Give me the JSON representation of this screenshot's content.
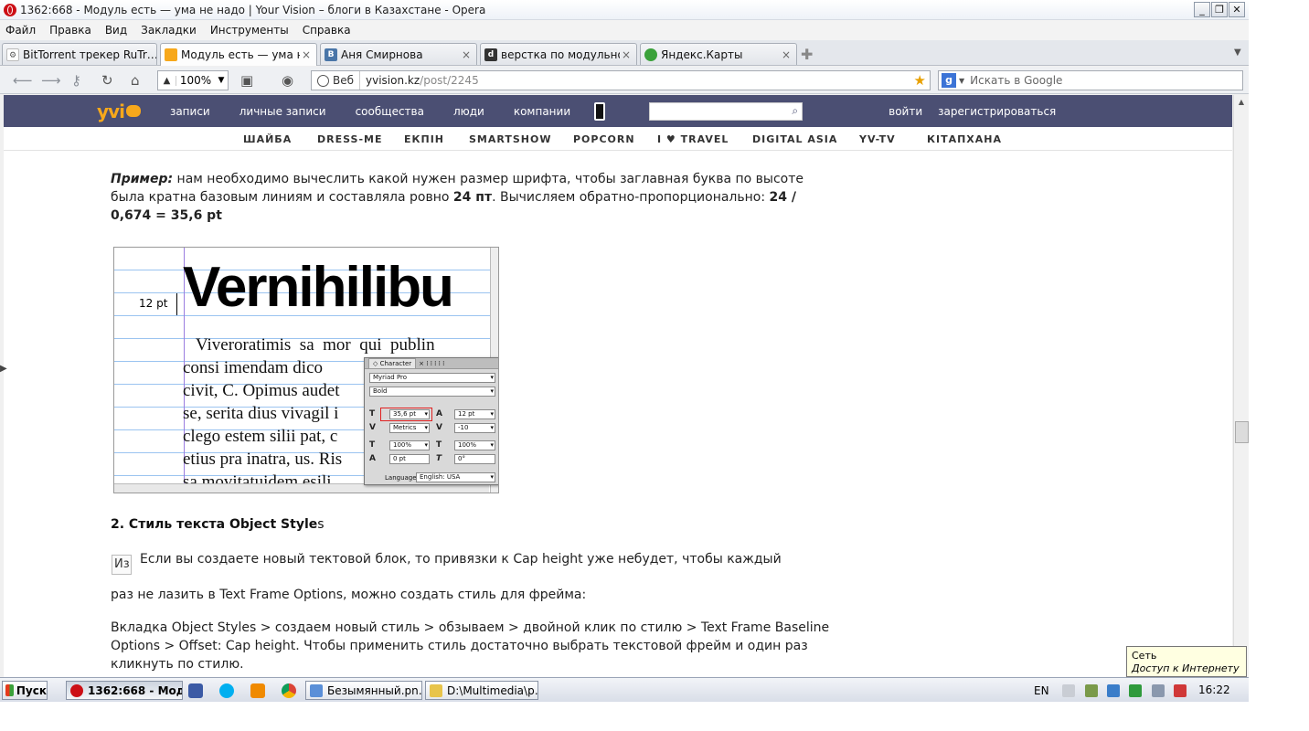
{
  "window": {
    "title": "1362:668 - Модуль есть — ума не надо | Your Vision – блоги в Казахстане - Opera",
    "buttons": {
      "minimize": "_",
      "restore": "❐",
      "close": "✕"
    }
  },
  "menu": [
    "Файл",
    "Правка",
    "Вид",
    "Закладки",
    "Инструменты",
    "Справка"
  ],
  "tabs": [
    {
      "label": "BitTorrent трекер RuTr…",
      "icon": "rutracker-icon",
      "active": false
    },
    {
      "label": "Модуль есть — ума н…",
      "icon": "yvision-icon",
      "active": true
    },
    {
      "label": "Аня Смирнова",
      "icon": "vk-icon",
      "active": false
    },
    {
      "label": "верстка по модульно…",
      "icon": "dcp-icon",
      "active": false
    },
    {
      "label": "Яндекс.Карты",
      "icon": "yandex-maps-icon",
      "active": false
    }
  ],
  "tab_close": "×",
  "addressbar": {
    "zoom": "100%",
    "web_label": "Веб",
    "url_host": "yvision.kz",
    "url_path": "/post/2245",
    "search_placeholder": "Искать в Google"
  },
  "site": {
    "logo": "yvi",
    "nav": [
      "записи",
      "личные записи",
      "сообщества",
      "люди",
      "компании"
    ],
    "login": "войти",
    "register": "зарегистрироваться",
    "subnav": [
      "ШАЙБА",
      "DRESS-ME",
      "ЕКПІН",
      "SMARTSHOW",
      "POPCORN",
      "I ♥ TRAVEL",
      "DIGITAL ASIA",
      "YV-TV",
      "КІТАПХАНА"
    ]
  },
  "article": {
    "example_label": "Пример:",
    "example_text_1": " нам необходимо вычеслить какой нужен размер шрифта, чтобы заглавная буква по высоте была кратна базовым линиям и составляла ровно ",
    "example_bold_1": "24 пт",
    "example_text_2": ". Вычисляем обратно-пропорционально: ",
    "example_formula": "24 / 0,674 = 35,6 pt",
    "figure": {
      "heading": "Vernihilibu",
      "measure_label": "12 pt",
      "body_lines": [
        "   Viveroratimis  sa  mor  qui  publin",
        "consi imendam dico",
        "civit, C. Opimus audet",
        "se, serita dius vivagil i",
        "clego estem silii pat, c",
        "etius pra inatra, us. Ris",
        "sa movitatuidem esili"
      ],
      "panel": {
        "title": "◇ Character",
        "tab_marks": "× ⁞ ⁞ ⁞ ⁞ ⁞",
        "font_family": "Myriad Pro",
        "font_style": "Bold",
        "font_size": "35,6 pt",
        "leading": "12 pt",
        "kerning": "Metrics",
        "tracking": "-10",
        "vertical_scale": "100%",
        "horizontal_scale": "100%",
        "baseline_shift": "0 pt",
        "skew": "0°",
        "language_label": "Language:",
        "language": "English: USA"
      }
    },
    "section_heading": "2. Стиль текста Object Style",
    "section_heading_suffix": "s",
    "broken_image_alt": "Из",
    "para_1": "Если вы создаете новый тектовой блок, то привязки к Cap height уже небудет, чтобы каждый",
    "para_2": "раз не лазить в Text Frame Options, можно создать стиль для фрейма:",
    "para_3": "Вкладка Object Styles > создаем новый стиль > обзываем > двойной клик по стилю > Text Frame Baseline Options > Offset: Cap height. Чтобы применить стиль достаточно выбрать текстовой фрейм и один раз кликнуть по стилю."
  },
  "tooltip": {
    "title": "Сеть",
    "text": "Доступ к Интернету"
  },
  "taskbar": {
    "start": "Пуск",
    "tasks": [
      {
        "label": "1362:668 - Мод…",
        "icon": "opera-icon",
        "active": true
      },
      {
        "label": "Безымянный.pn…",
        "icon": "paint-icon",
        "active": false
      },
      {
        "label": "D:\\Multimedia\\p…",
        "icon": "folder-icon",
        "active": false
      }
    ],
    "language": "EN",
    "clock": "16:22"
  }
}
